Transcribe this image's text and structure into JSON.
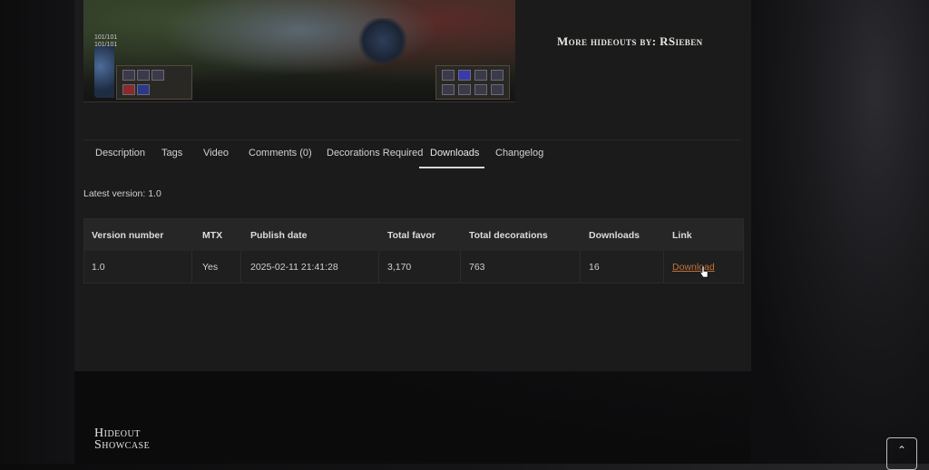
{
  "more_hideouts": "More hideouts by: RSieben",
  "hud": {
    "left_top": "101/101",
    "left_bottom": "101/101"
  },
  "tabs": [
    {
      "label": "Description"
    },
    {
      "label": "Tags"
    },
    {
      "label": "Video"
    },
    {
      "label": "Comments (0)"
    },
    {
      "label": "Decorations Required"
    },
    {
      "label": "Downloads"
    },
    {
      "label": "Changelog"
    }
  ],
  "active_tab": "Downloads",
  "latest_version": "Latest version: 1.0",
  "table": {
    "headers": [
      "Version number",
      "MTX",
      "Publish date",
      "Total favor",
      "Total decorations",
      "Downloads",
      "Link"
    ],
    "rows": [
      {
        "version": "1.0",
        "mtx": "Yes",
        "publish_date": "2025-02-11 21:41:28",
        "total_favor": "3,170",
        "total_decorations": "763",
        "downloads": "16",
        "link": "Download"
      }
    ]
  },
  "logo": {
    "line1": "Hideout",
    "line2": "Showcase"
  },
  "scroll_top_icon": "chevron-up-icon",
  "colors": {
    "link": "#c0713a",
    "panel": "#1b1b1b"
  }
}
